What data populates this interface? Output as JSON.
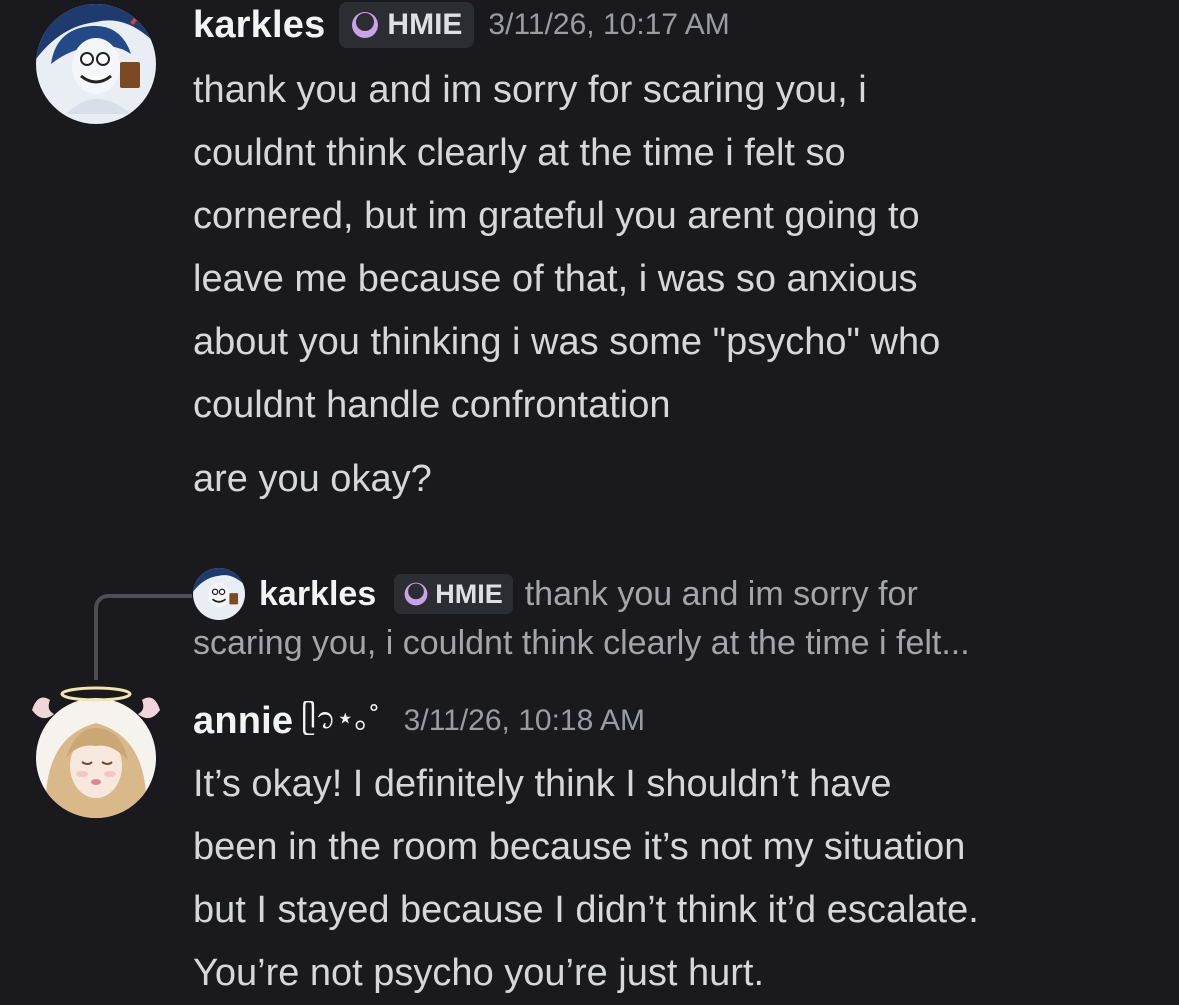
{
  "messages": [
    {
      "username": "karkles",
      "tag": "HMIE",
      "timestamp": "3/11/26, 10:17 AM",
      "lines": [
        "thank you and im sorry for scaring you, i",
        "couldnt think clearly at the time i felt so",
        "cornered, but im grateful you arent going to",
        "leave me because of that, i was so anxious",
        "about you thinking i was some \"psycho\" who",
        "couldnt handle confrontation"
      ],
      "followup": "are you okay?"
    },
    {
      "reply": {
        "username": "karkles",
        "tag": "HMIE",
        "preview_line1": "thank you and im sorry for",
        "preview_line2": "scaring you, i couldnt think clearly at the time i felt..."
      },
      "username": "annie",
      "username_decoration": "ᥫ᭡⋆｡˚",
      "timestamp": "3/11/26, 10:18 AM",
      "lines": [
        "It’s okay! I definitely think I shouldn’t have",
        "been in the room because it’s not my situation",
        "but I stayed because I didn’t think it’d escalate.",
        "You’re not psycho you’re just hurt."
      ]
    }
  ],
  "colors": {
    "background": "#1a1a1e",
    "tag_background": "#2c2d33",
    "tag_icon": "#c9a2e8",
    "timestamp": "#9a9ca3",
    "reply_line": "#4c4d55"
  },
  "icons": {
    "tag": "moon-tag-icon"
  }
}
